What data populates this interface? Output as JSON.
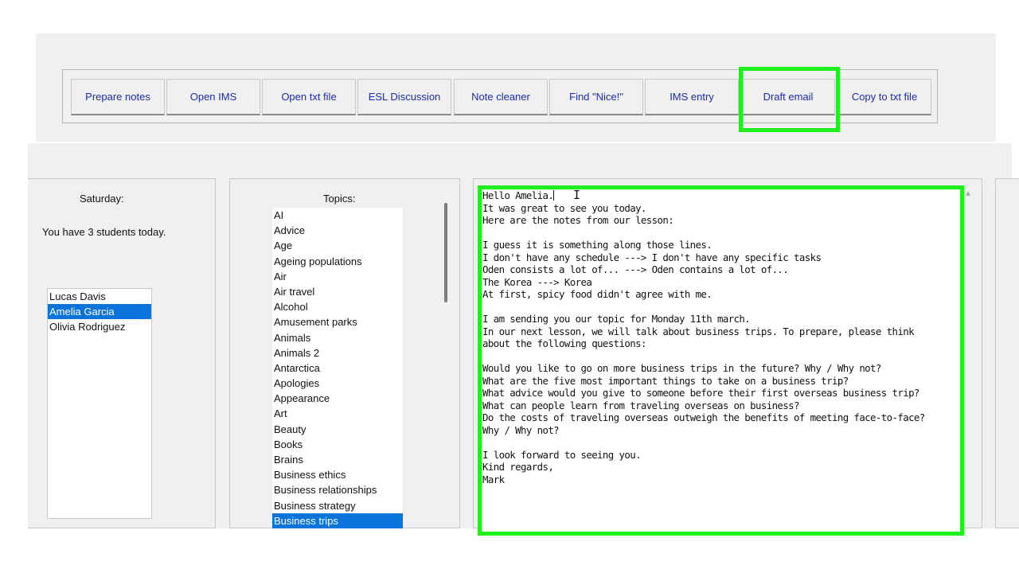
{
  "toolbar": {
    "buttons": [
      {
        "label": "Prepare notes"
      },
      {
        "label": "Open IMS"
      },
      {
        "label": "Open txt file"
      },
      {
        "label": "ESL Discussion"
      },
      {
        "label": "Note cleaner"
      },
      {
        "label": "Find \"Nice!\""
      },
      {
        "label": "IMS entry"
      },
      {
        "label": "Draft email"
      },
      {
        "label": "Copy to txt file"
      }
    ],
    "highlight_color": "#1ef01e"
  },
  "day_panel": {
    "day_label": "Saturday:",
    "students_message": "You have 3 students today.",
    "students": [
      "Lucas Davis",
      "Amelia Garcia",
      "Olivia Rodriguez"
    ],
    "selected_student": "Amelia Garcia"
  },
  "topics_panel": {
    "heading": "Topics:",
    "topics": [
      "AI",
      "Advice",
      "Age",
      "Ageing populations",
      "Air",
      "Air travel",
      "Alcohol",
      "Amusement parks",
      "Animals",
      "Animals 2",
      "Antarctica",
      "Apologies",
      "Appearance",
      "Art",
      "Beauty",
      "Books",
      "Brains",
      "Business ethics",
      "Business relationships",
      "Business strategy",
      "Business trips"
    ],
    "selected_topic": "Business trips",
    "selection_color": "#0a74da"
  },
  "email_editor": {
    "lines": [
      "Hello Amelia.",
      "It was great to see you today.",
      "Here are the notes from our lesson:",
      "",
      "I guess it is something along those lines.",
      "I don't have any schedule ---> I don't have any specific tasks",
      "Oden consists a lot of... ---> Oden contains a lot of...",
      "The Korea ---> Korea",
      "At first, spicy food didn't agree with me.",
      "",
      "I am sending you our topic for Monday 11th march.",
      "In our next lesson, we will talk about business trips. To prepare, please think",
      "about the following questions:",
      "",
      "Would you like to go on more business trips in the future? Why / Why not?",
      "What are the five most important things to take on a business trip?",
      "What advice would you give to someone before their first overseas business trip?",
      "What can people learn from traveling overseas on business?",
      "Do the costs of traveling overseas outweigh the benefits of meeting face-to-face?",
      "Why / Why not?",
      "",
      "I look forward to seeing you.",
      "Kind regards,",
      "Mark"
    ],
    "highlight_color": "#1ef01e"
  }
}
